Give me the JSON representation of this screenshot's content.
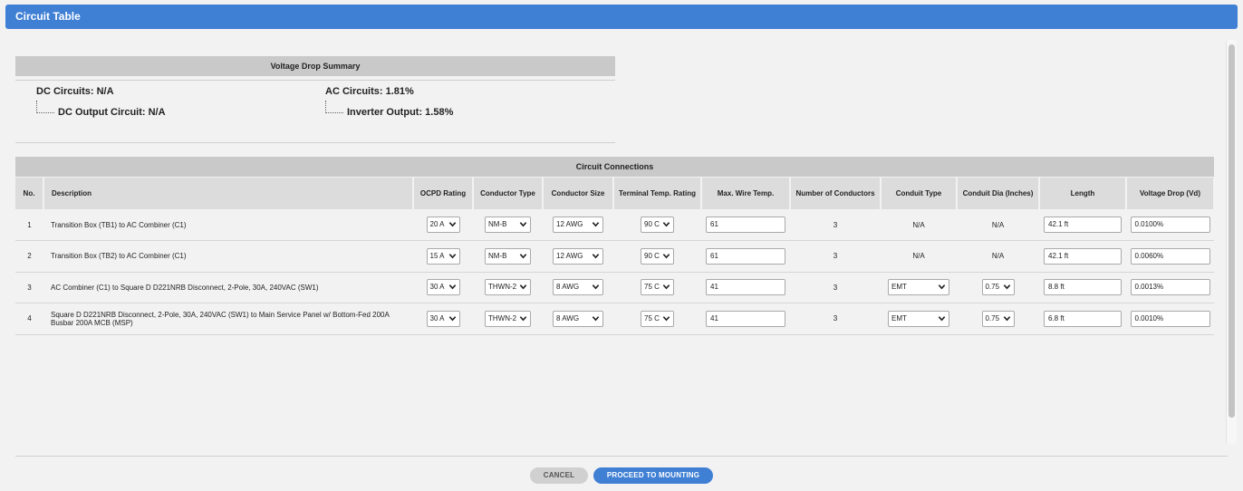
{
  "window": {
    "title": "Circuit Table"
  },
  "voltage_drop_summary": {
    "title": "Voltage Drop Summary",
    "dc_circuits": "DC Circuits: N/A",
    "dc_output_circuit": "DC Output Circuit: N/A",
    "ac_circuits": "AC Circuits: 1.81%",
    "inverter_output": "Inverter Output: 1.58%"
  },
  "circuit_connections": {
    "title": "Circuit Connections",
    "columns": [
      "No.",
      "Description",
      "OCPD Rating",
      "Conductor Type",
      "Conductor Size",
      "Terminal Temp. Rating",
      "Max. Wire Temp.",
      "Number of Conductors",
      "Conduit Type",
      "Conduit Dia (Inches)",
      "Length",
      "Voltage Drop (Vd)"
    ],
    "rows": [
      {
        "no": "1",
        "description": "Transition Box (TB1) to AC Combiner (C1)",
        "ocpd": "20 A",
        "conductor_type": "NM-B",
        "conductor_size": "12 AWG",
        "terminal_temp": "90 C",
        "max_wire_temp": "61",
        "num_conductors": "3",
        "conduit_type": "N/A",
        "conduit_dia": "N/A",
        "length": "42.1 ft",
        "voltage_drop": "0.0100%"
      },
      {
        "no": "2",
        "description": "Transition Box (TB2) to AC Combiner (C1)",
        "ocpd": "15 A",
        "conductor_type": "NM-B",
        "conductor_size": "12 AWG",
        "terminal_temp": "90 C",
        "max_wire_temp": "61",
        "num_conductors": "3",
        "conduit_type": "N/A",
        "conduit_dia": "N/A",
        "length": "42.1 ft",
        "voltage_drop": "0.0060%"
      },
      {
        "no": "3",
        "description": "AC Combiner (C1) to Square D D221NRB Disconnect, 2-Pole, 30A, 240VAC (SW1)",
        "ocpd": "30 A",
        "conductor_type": "THWN-2",
        "conductor_size": "8 AWG",
        "terminal_temp": "75 C",
        "max_wire_temp": "41",
        "num_conductors": "3",
        "conduit_type": "EMT",
        "conduit_dia": "0.75",
        "length": "8.8 ft",
        "voltage_drop": "0.0013%"
      },
      {
        "no": "4",
        "description": "Square D D221NRB Disconnect, 2-Pole, 30A, 240VAC (SW1) to Main Service Panel w/ Bottom-Fed 200A Busbar 200A MCB (MSP)",
        "ocpd": "30 A",
        "conductor_type": "THWN-2",
        "conductor_size": "8 AWG",
        "terminal_temp": "75 C",
        "max_wire_temp": "41",
        "num_conductors": "3",
        "conduit_type": "EMT",
        "conduit_dia": "0.75",
        "length": "6.8 ft",
        "voltage_drop": "0.0010%"
      }
    ]
  },
  "footer": {
    "cancel_label": "CANCEL",
    "proceed_label": "PROCEED TO MOUNTING"
  },
  "colors": {
    "accent": "#3f7fd4",
    "header_gray": "#c9c9c9",
    "background": "#f2f2f2"
  }
}
